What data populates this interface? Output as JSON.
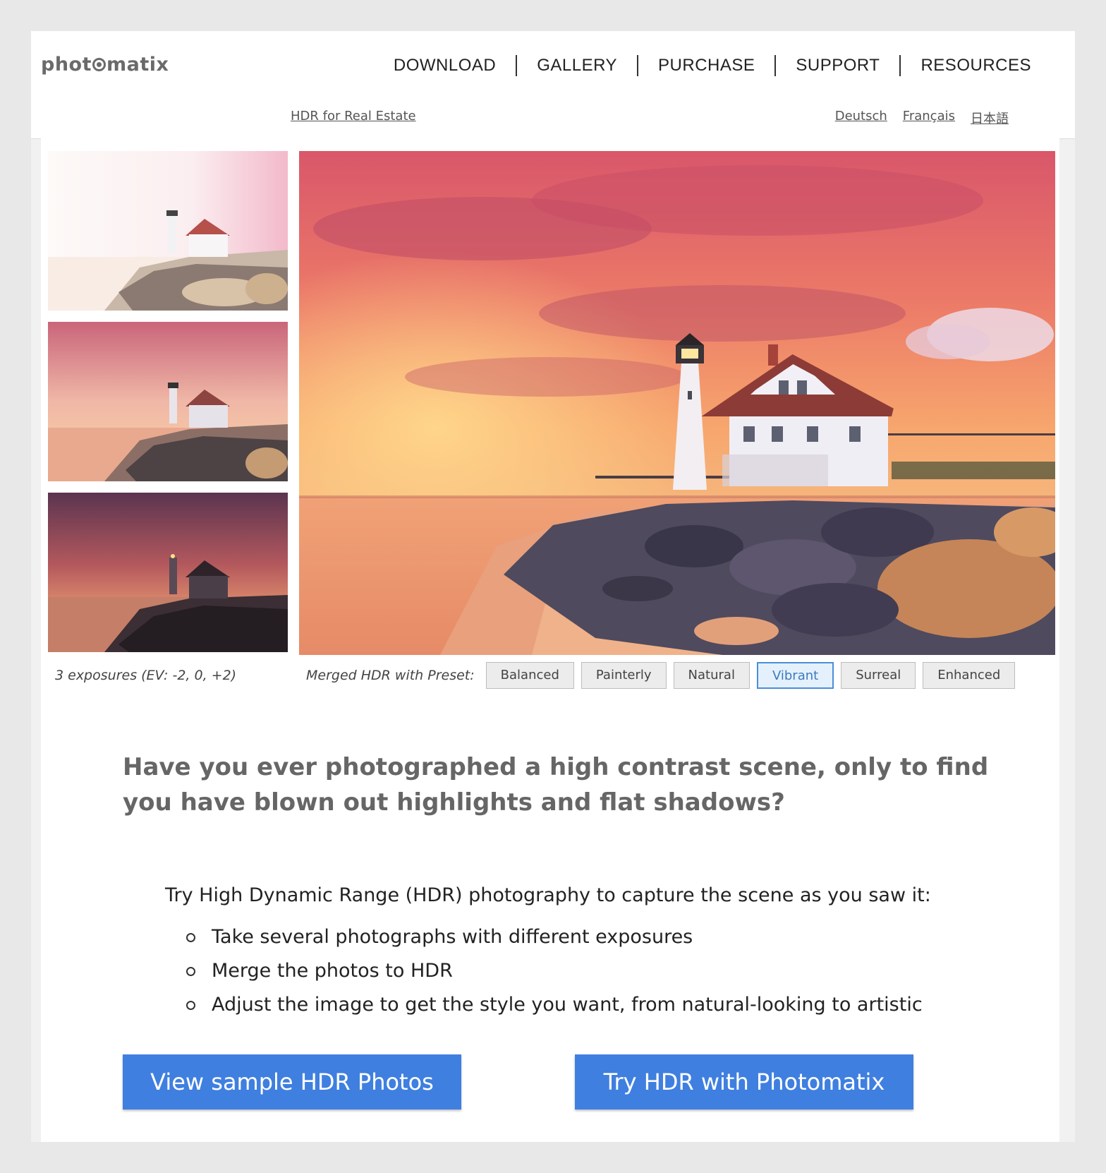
{
  "header": {
    "logo_before": "phot",
    "logo_after": "matix",
    "nav": [
      "DOWNLOAD",
      "GALLERY",
      "PURCHASE",
      "SUPPORT",
      "RESOURCES"
    ],
    "sublink": "HDR for Real Estate",
    "languages": [
      "Deutsch",
      "Français",
      "日本語"
    ]
  },
  "gallery": {
    "exposure_caption": "3 exposures (EV: -2, 0, +2)",
    "preset_label": "Merged HDR with Preset:",
    "presets": [
      "Balanced",
      "Painterly",
      "Natural",
      "Vibrant",
      "Surreal",
      "Enhanced"
    ],
    "active_preset": "Vibrant"
  },
  "main": {
    "headline": "Have you ever photographed a high contrast scene, only to find you have blown out highlights and flat shadows?",
    "intro": "Try High Dynamic Range (HDR) photography to capture the scene as you saw it:",
    "steps": [
      "Take several photographs with different exposures",
      "Merge the photos to HDR",
      "Adjust the image to get the style you want, from natural-looking to artistic"
    ]
  },
  "buttons": {
    "sample": "View sample HDR Photos",
    "try": "Try HDR with Photomatix"
  },
  "colors": {
    "cta_blue": "#3f7fe0",
    "active_preset_border": "#4a8fd8"
  }
}
